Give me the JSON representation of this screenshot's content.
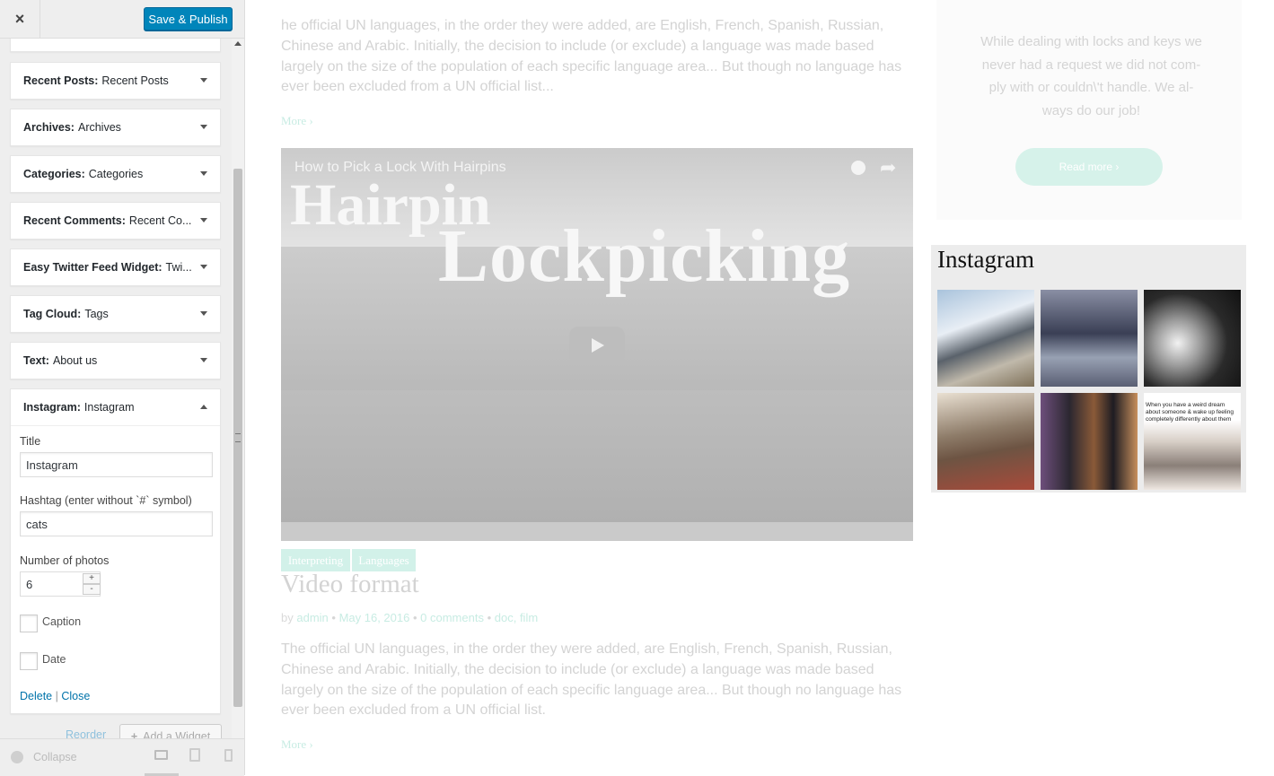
{
  "header": {
    "close_icon": "×",
    "publish_label": "Save & Publish"
  },
  "widgets": [
    {
      "type": "Recent Posts:",
      "title": "Recent Posts"
    },
    {
      "type": "Archives:",
      "title": "Archives"
    },
    {
      "type": "Categories:",
      "title": "Categories"
    },
    {
      "type": "Recent Comments:",
      "title": "Recent Co..."
    },
    {
      "type": "Easy Twitter Feed Widget:",
      "title": "Twi..."
    },
    {
      "type": "Tag Cloud:",
      "title": "Tags"
    },
    {
      "type": "Text:",
      "title": "About us"
    },
    {
      "type": "Instagram:",
      "title": "Instagram"
    }
  ],
  "instagram_form": {
    "title_label": "Title",
    "title_value": "Instagram",
    "hashtag_label": "Hashtag (enter without `#` symbol)",
    "hashtag_value": "cats",
    "photos_label": "Number of photos",
    "photos_value": "6",
    "stepper_up": "+",
    "stepper_down": "-",
    "caption_label": "Caption",
    "date_label": "Date",
    "delete_label": "Delete",
    "separator": "|",
    "close_label": "Close"
  },
  "sidebar_footer": {
    "reorder_label": "Reorder",
    "add_widget_label": "Add a Widget",
    "collapse_label": "Collapse"
  },
  "preview": {
    "post1_excerpt": "he official UN languages, in the order they were added, are English, French, Spanish, Russian, Chinese and Arabic. Initially, the decision to include (or exclude) a language was made based largely on the size of the population of each specific language area... But though no language has ever been excluded from a UN official list...",
    "more_label": "More",
    "video_title": "How to Pick a Lock With Hairpins",
    "video_overlay_line1": "Hairpin",
    "video_overlay_line2": "Lockpicking",
    "tags": [
      "Interpreting",
      "Languages"
    ],
    "post2_title": "Video format",
    "post2_meta": {
      "by": "by",
      "author": "admin",
      "date": "May 16, 2016",
      "comments": "0 comments",
      "categories": "doc, film"
    },
    "post2_excerpt": "The official UN languages, in the order they were added, are English, French, Spanish, Russian, Chinese and Arabic. Initially, the decision to include (or exclude) a language was made based largely on the size of the population of each specific language area... But though no language has ever been excluded from a UN official list.",
    "about_text": "While dealing with locks and keys we never had a request we did not com- ply with or couldn\\'t handle. We al- ways do our job!",
    "read_more_label": "Read more",
    "instagram_heading": "Instagram",
    "instagram_caption_snippet": "When you have a weird dream about someone & wake up feeling completely differently about them"
  }
}
